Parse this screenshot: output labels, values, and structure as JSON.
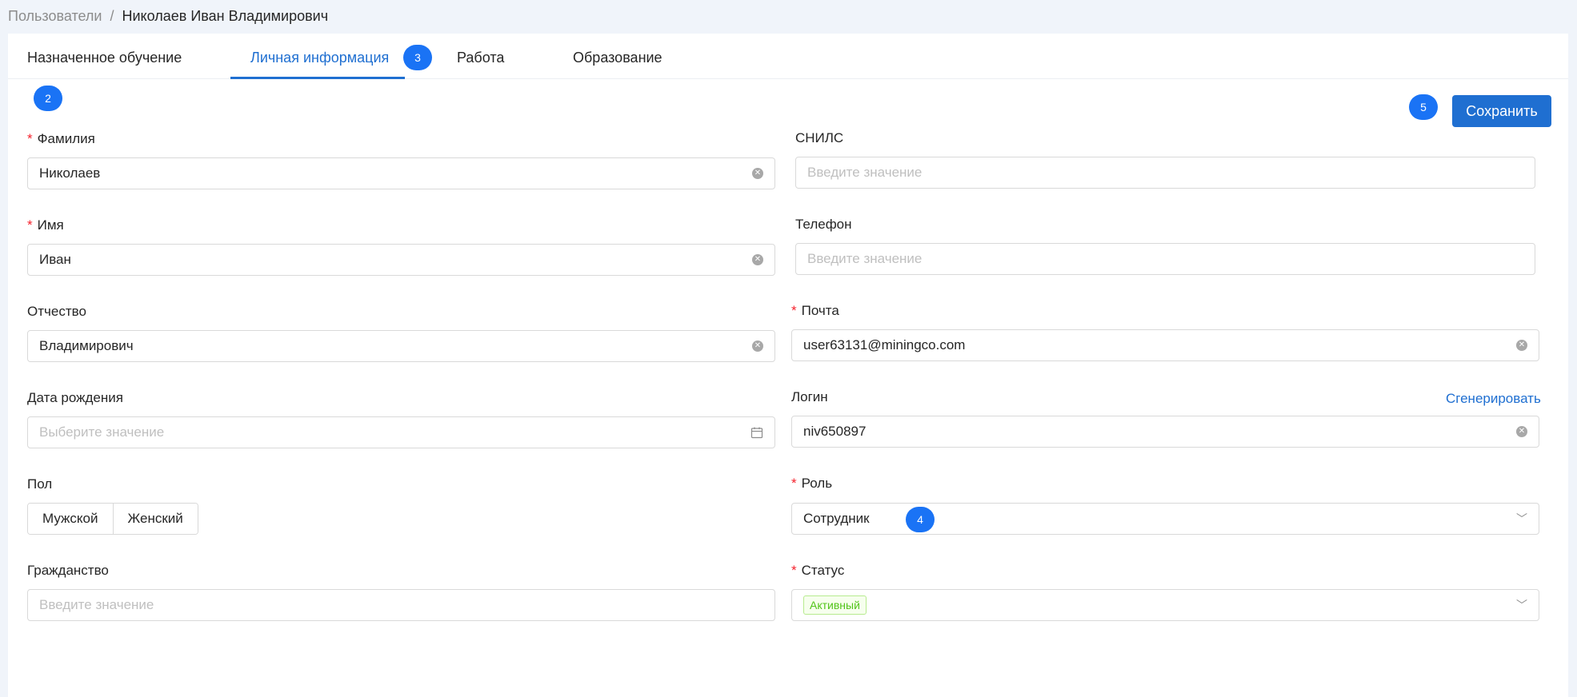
{
  "breadcrumb": {
    "parent": "Пользователи",
    "separator": "/",
    "current": "Николаев Иван Владимирович"
  },
  "tabs": [
    {
      "label": "Назначенное обучение",
      "active": false
    },
    {
      "label": "Личная информация",
      "active": true
    },
    {
      "label": "Работа",
      "active": false
    },
    {
      "label": "Образование",
      "active": false
    }
  ],
  "badges": {
    "b2": "2",
    "b3": "3",
    "b4": "4",
    "b5": "5"
  },
  "actions": {
    "save_label": "Сохранить",
    "generate_label": "Сгенерировать"
  },
  "form": {
    "last_name": {
      "label": "Фамилия",
      "required": true,
      "value": "Николаев"
    },
    "first_name": {
      "label": "Имя",
      "required": true,
      "value": "Иван"
    },
    "middle_name": {
      "label": "Отчество",
      "required": false,
      "value": "Владимирович"
    },
    "birth_date": {
      "label": "Дата рождения",
      "placeholder": "Выберите значение"
    },
    "gender": {
      "label": "Пол",
      "options": [
        "Мужской",
        "Женский"
      ]
    },
    "citizenship": {
      "label": "Гражданство",
      "placeholder": "Введите значение"
    },
    "snils": {
      "label": "СНИЛС",
      "placeholder": "Введите значение"
    },
    "phone": {
      "label": "Телефон",
      "placeholder": "Введите значение"
    },
    "email": {
      "label": "Почта",
      "required": true,
      "value": "user63131@miningco.com"
    },
    "login": {
      "label": "Логин",
      "value": "niv650897"
    },
    "role": {
      "label": "Роль",
      "required": true,
      "value": "Сотрудник"
    },
    "status": {
      "label": "Статус",
      "required": true,
      "value": "Активный"
    }
  },
  "required_mark": "*",
  "icons": {
    "clear": "close-circle-icon",
    "calendar": "calendar-icon",
    "chevron": "chevron-down-icon"
  },
  "colors": {
    "accent": "#1f6fd1",
    "badge": "#1a73f5",
    "required": "#f5222d",
    "status_active": "#52c41a"
  }
}
